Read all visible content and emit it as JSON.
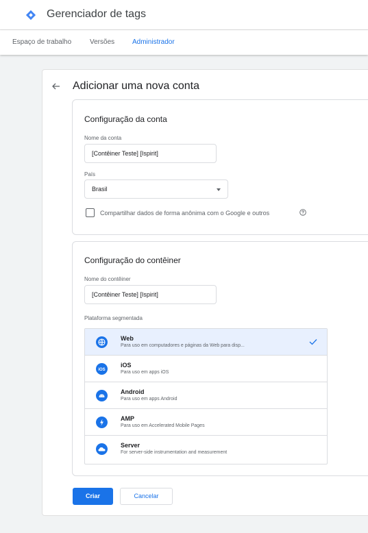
{
  "header": {
    "app_title": "Gerenciador de tags"
  },
  "nav": {
    "tabs": [
      {
        "label": "Espaço de trabalho",
        "active": false
      },
      {
        "label": "Versões",
        "active": false
      },
      {
        "label": "Administrador",
        "active": true
      }
    ]
  },
  "page": {
    "title": "Adicionar uma nova conta"
  },
  "account_section": {
    "title": "Configuração da conta",
    "account_name_label": "Nome da conta",
    "account_name_value": "[Contêiner Teste] [Ispirit]",
    "country_label": "País",
    "country_value": "Brasil",
    "share_label": "Compartilhar dados de forma anônima com o Google e outros",
    "share_checked": false
  },
  "container_section": {
    "title": "Configuração do contêiner",
    "container_name_label": "Nome do contêiner",
    "container_name_value": "[Contêiner Teste] [Ispirit]",
    "platform_label": "Plataforma segmentada",
    "platforms": [
      {
        "name": "Web",
        "description": "Para uso em computadores e páginas da Web para disp...",
        "icon": "globe-icon",
        "selected": true
      },
      {
        "name": "iOS",
        "description": "Para uso em apps iOS",
        "icon": "ios-icon",
        "selected": false
      },
      {
        "name": "Android",
        "description": "Para uso em apps Android",
        "icon": "android-icon",
        "selected": false
      },
      {
        "name": "AMP",
        "description": "Para uso em Accelerated Mobile Pages",
        "icon": "amp-icon",
        "selected": false
      },
      {
        "name": "Server",
        "description": "For server-side instrumentation and measurement",
        "icon": "cloud-icon",
        "selected": false
      }
    ]
  },
  "actions": {
    "create_label": "Criar",
    "cancel_label": "Cancelar"
  },
  "colors": {
    "accent": "#1a73e8",
    "selected_row": "#e8f0fe",
    "background": "#f1f3f4"
  }
}
